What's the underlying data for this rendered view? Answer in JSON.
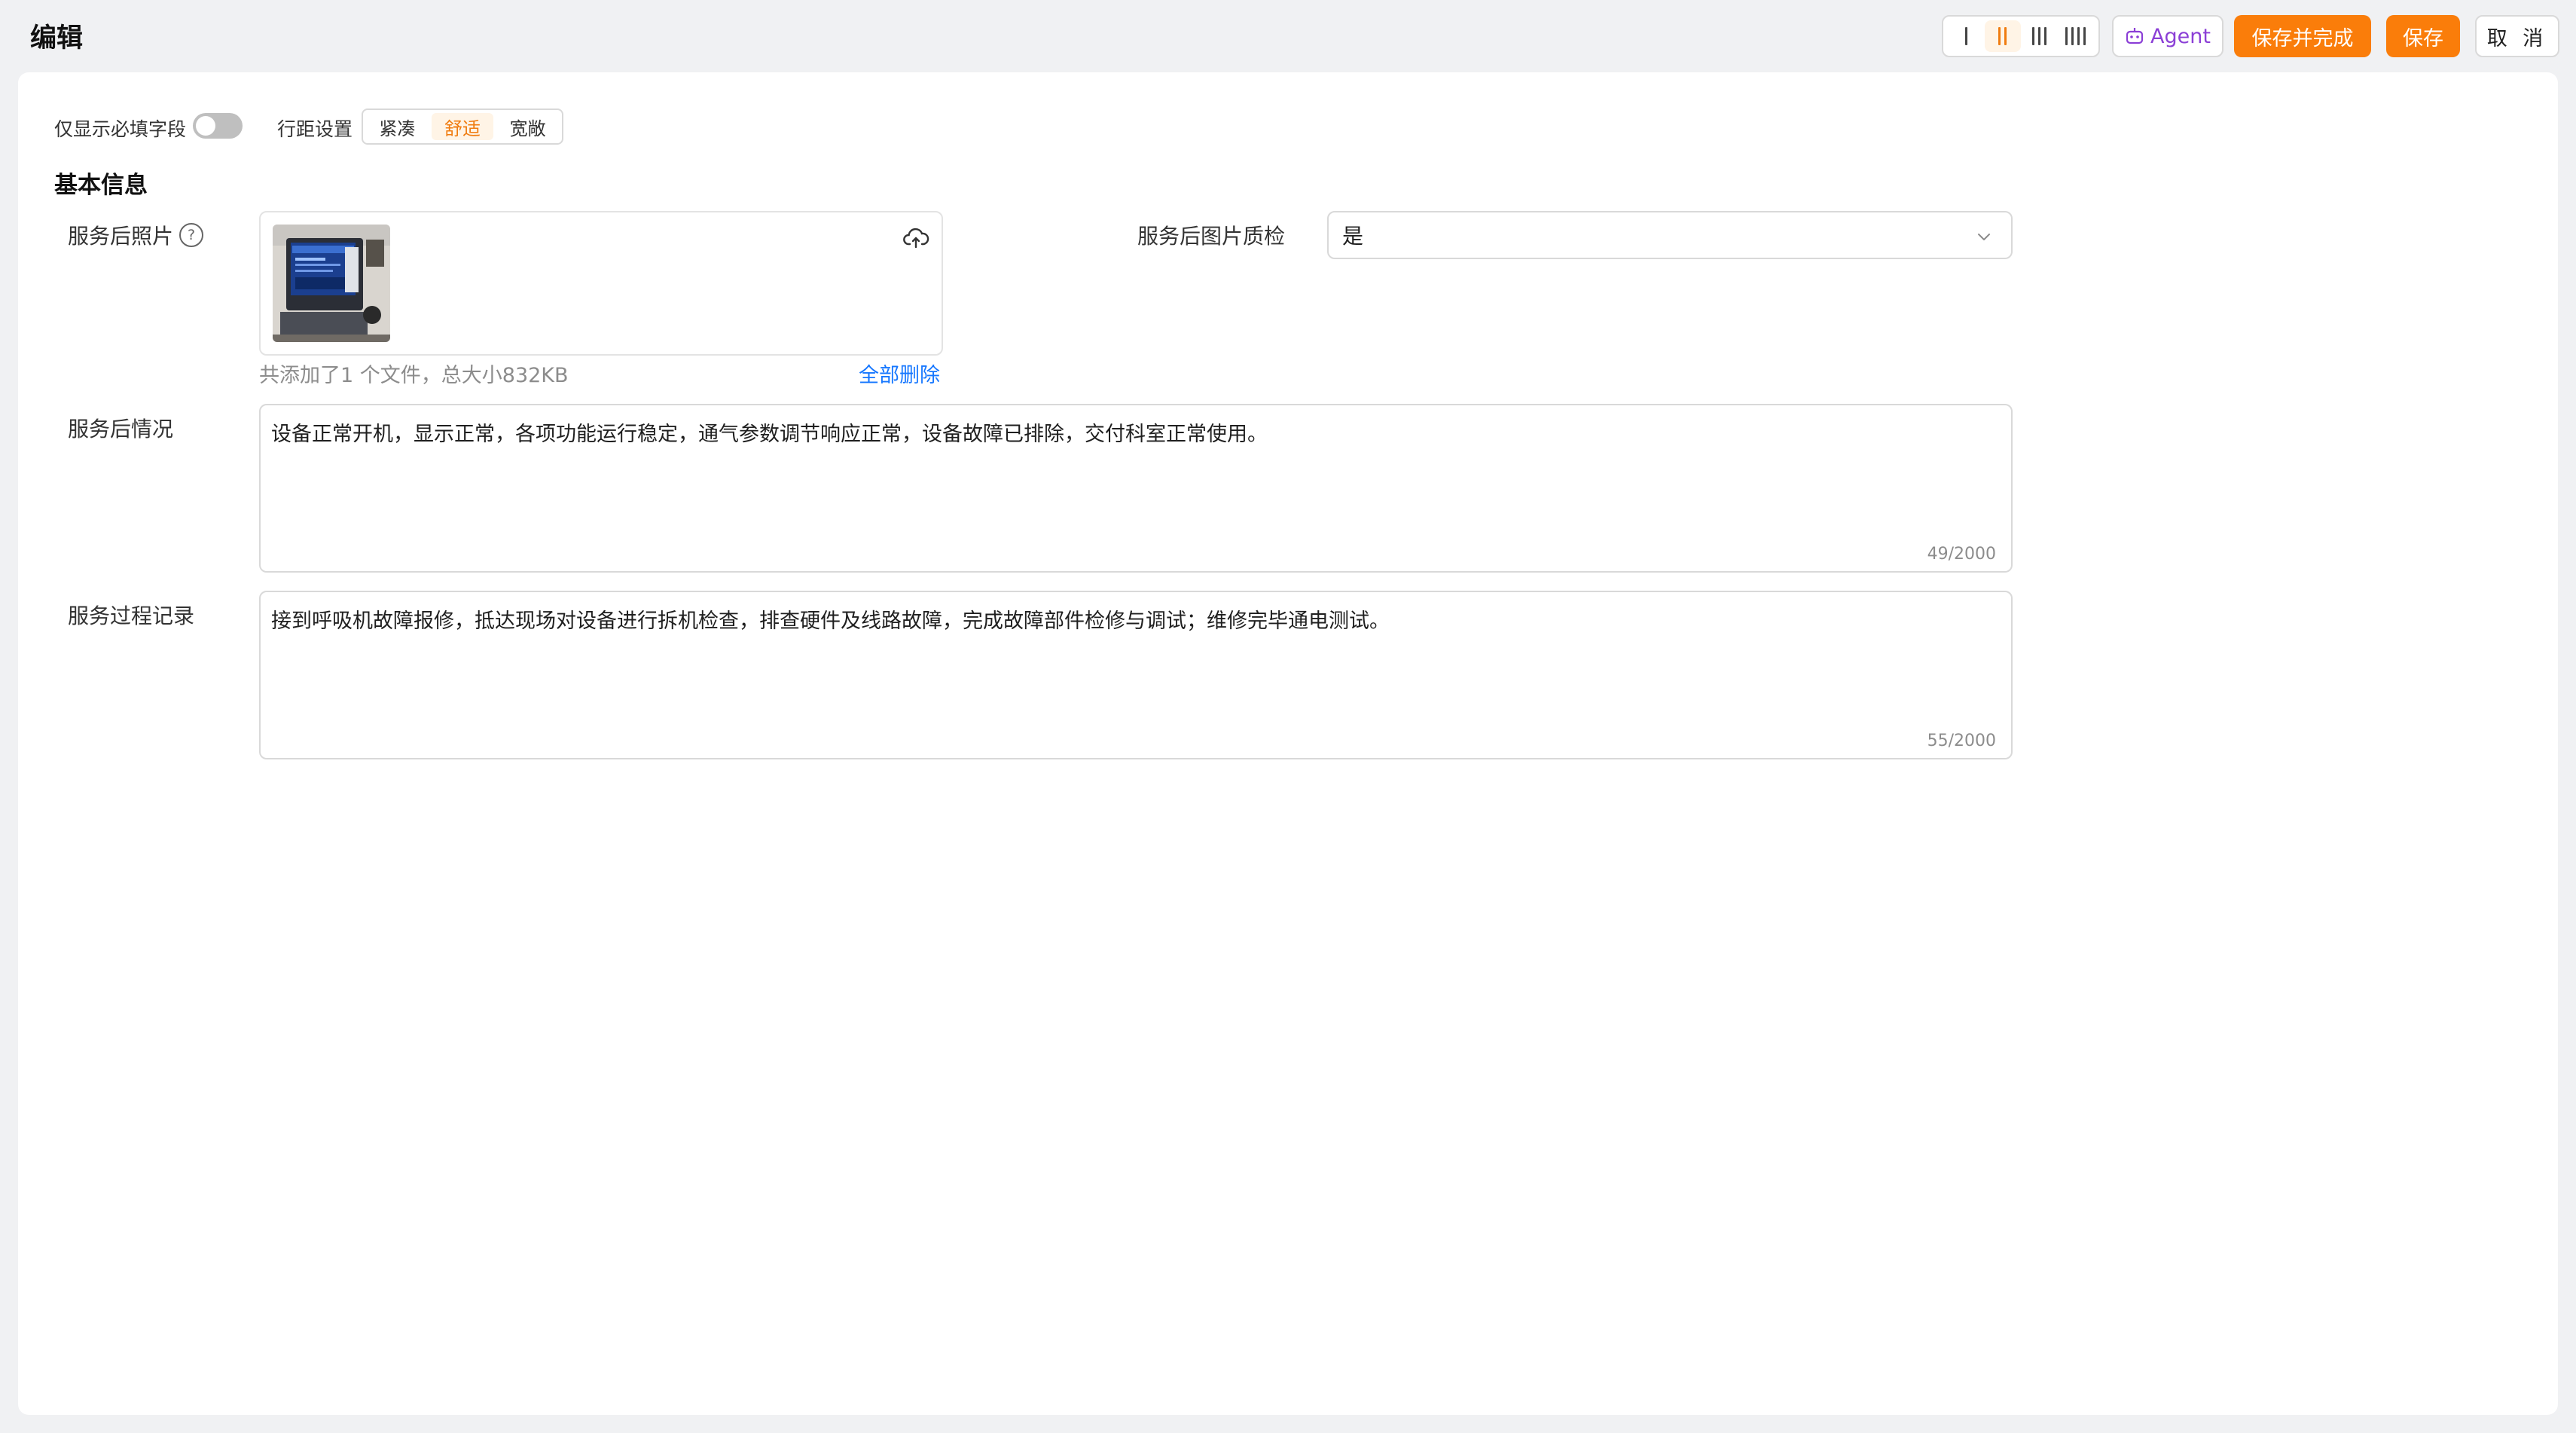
{
  "header": {
    "title": "编辑",
    "column_layout": {
      "selected": 2,
      "options": [
        1,
        2,
        3,
        4
      ]
    },
    "agent_label": "Agent",
    "save_complete_label": "保存并完成",
    "save_label": "保存",
    "cancel_label": "取 消"
  },
  "toolbar": {
    "required_only_label": "仅显示必填字段",
    "required_only_on": false,
    "spacing_label": "行距设置",
    "spacing_options": [
      "紧凑",
      "舒适",
      "宽敞"
    ],
    "spacing_selected": "舒适"
  },
  "section": {
    "title": "基本信息",
    "photo": {
      "label": "服务后照片",
      "file_info": "共添加了1 个文件，总大小832KB",
      "delete_all": "全部删除"
    },
    "quality_check": {
      "label": "服务后图片质检",
      "value": "是"
    },
    "after_service": {
      "label": "服务后情况",
      "value": "设备正常开机，显示正常，各项功能运行稳定，通气参数调节响应正常，设备故障已排除，交付科室正常使用。",
      "counter": "49/2000"
    },
    "process_record": {
      "label": "服务过程记录",
      "value": "接到呼吸机故障报修，抵达现场对设备进行拆机检查，排查硬件及线路故障，完成故障部件检修与调试；维修完毕通电测试。",
      "counter": "55/2000"
    }
  },
  "colors": {
    "accent": "#fa7d0a",
    "link": "#1677ff",
    "agent": "#8b3fd6"
  }
}
